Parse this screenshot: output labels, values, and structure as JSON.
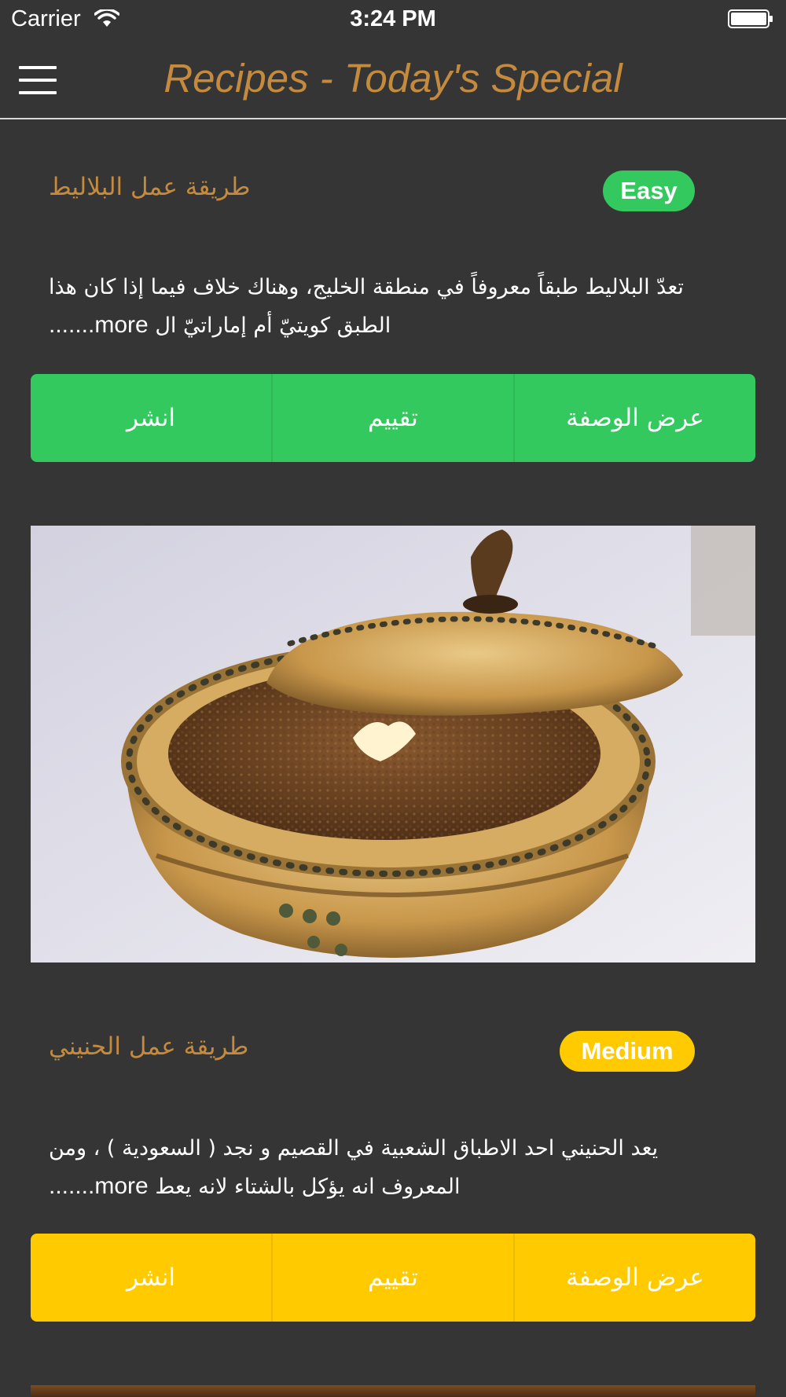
{
  "status_bar": {
    "carrier": "Carrier",
    "time": "3:24 PM"
  },
  "nav": {
    "title": "Recipes - Today's Special",
    "menu_icon": "hamburger-menu-icon"
  },
  "colors": {
    "background": "#353535",
    "accent": "#c48b3f",
    "easy": "#33c95e",
    "medium": "#ffca00"
  },
  "recipes": [
    {
      "title": "طريقة عمل البلاليط",
      "difficulty": "Easy",
      "description_1": "تعدّ البلاليط طبقاً معروفاً في منطقة الخليج، وهناك خلاف فيما إذا كان هذا",
      "description_2": "الطبق كويتيّ أم إماراتيّ ال",
      "more": "more.......",
      "actions": {
        "view": "عرض الوصفة",
        "rate": "تقييم",
        "share": "انشر"
      }
    },
    {
      "title": "طريقة عمل الحنيني",
      "difficulty": "Medium",
      "description_1": "يعد الحنيني احد الاطباق الشعبية في القصيم و نجد ( السعودية ) ، ومن",
      "description_2": "المعروف انه يؤكل بالشتاء لانه يعط",
      "more": "more.......",
      "actions": {
        "view": "عرض الوصفة",
        "rate": "تقييم",
        "share": "انشر"
      }
    }
  ]
}
